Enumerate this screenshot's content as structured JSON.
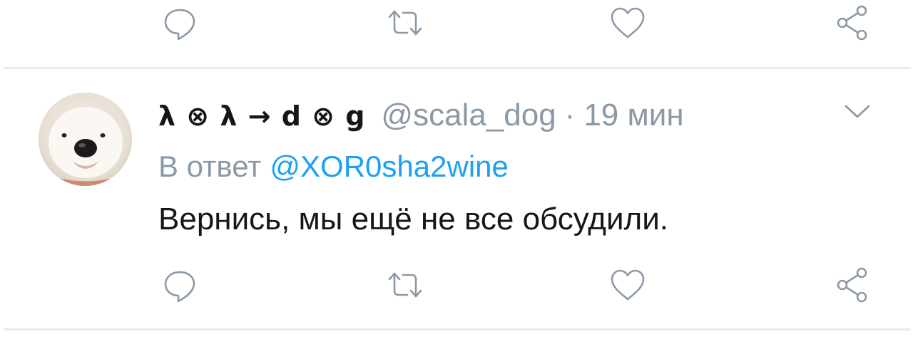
{
  "icons": {
    "reply": "reply-icon",
    "retweet": "retweet-icon",
    "like": "heart-icon",
    "share": "share-icon",
    "more": "chevron-down-icon"
  },
  "colors": {
    "icon_gray": "#8b99a6",
    "link_blue": "#1da1f2",
    "text_dark": "#14171a",
    "divider": "#e6ecf0"
  },
  "tweet": {
    "display_name": "λ ⊗ λ → d ⊗ g",
    "handle": "@scala_dog",
    "separator": "·",
    "time": "19 мин",
    "reply_prefix": "В ответ",
    "reply_mention": "@XOR0sha2wine",
    "text": "Вернись, мы ещё не все обсудили."
  }
}
